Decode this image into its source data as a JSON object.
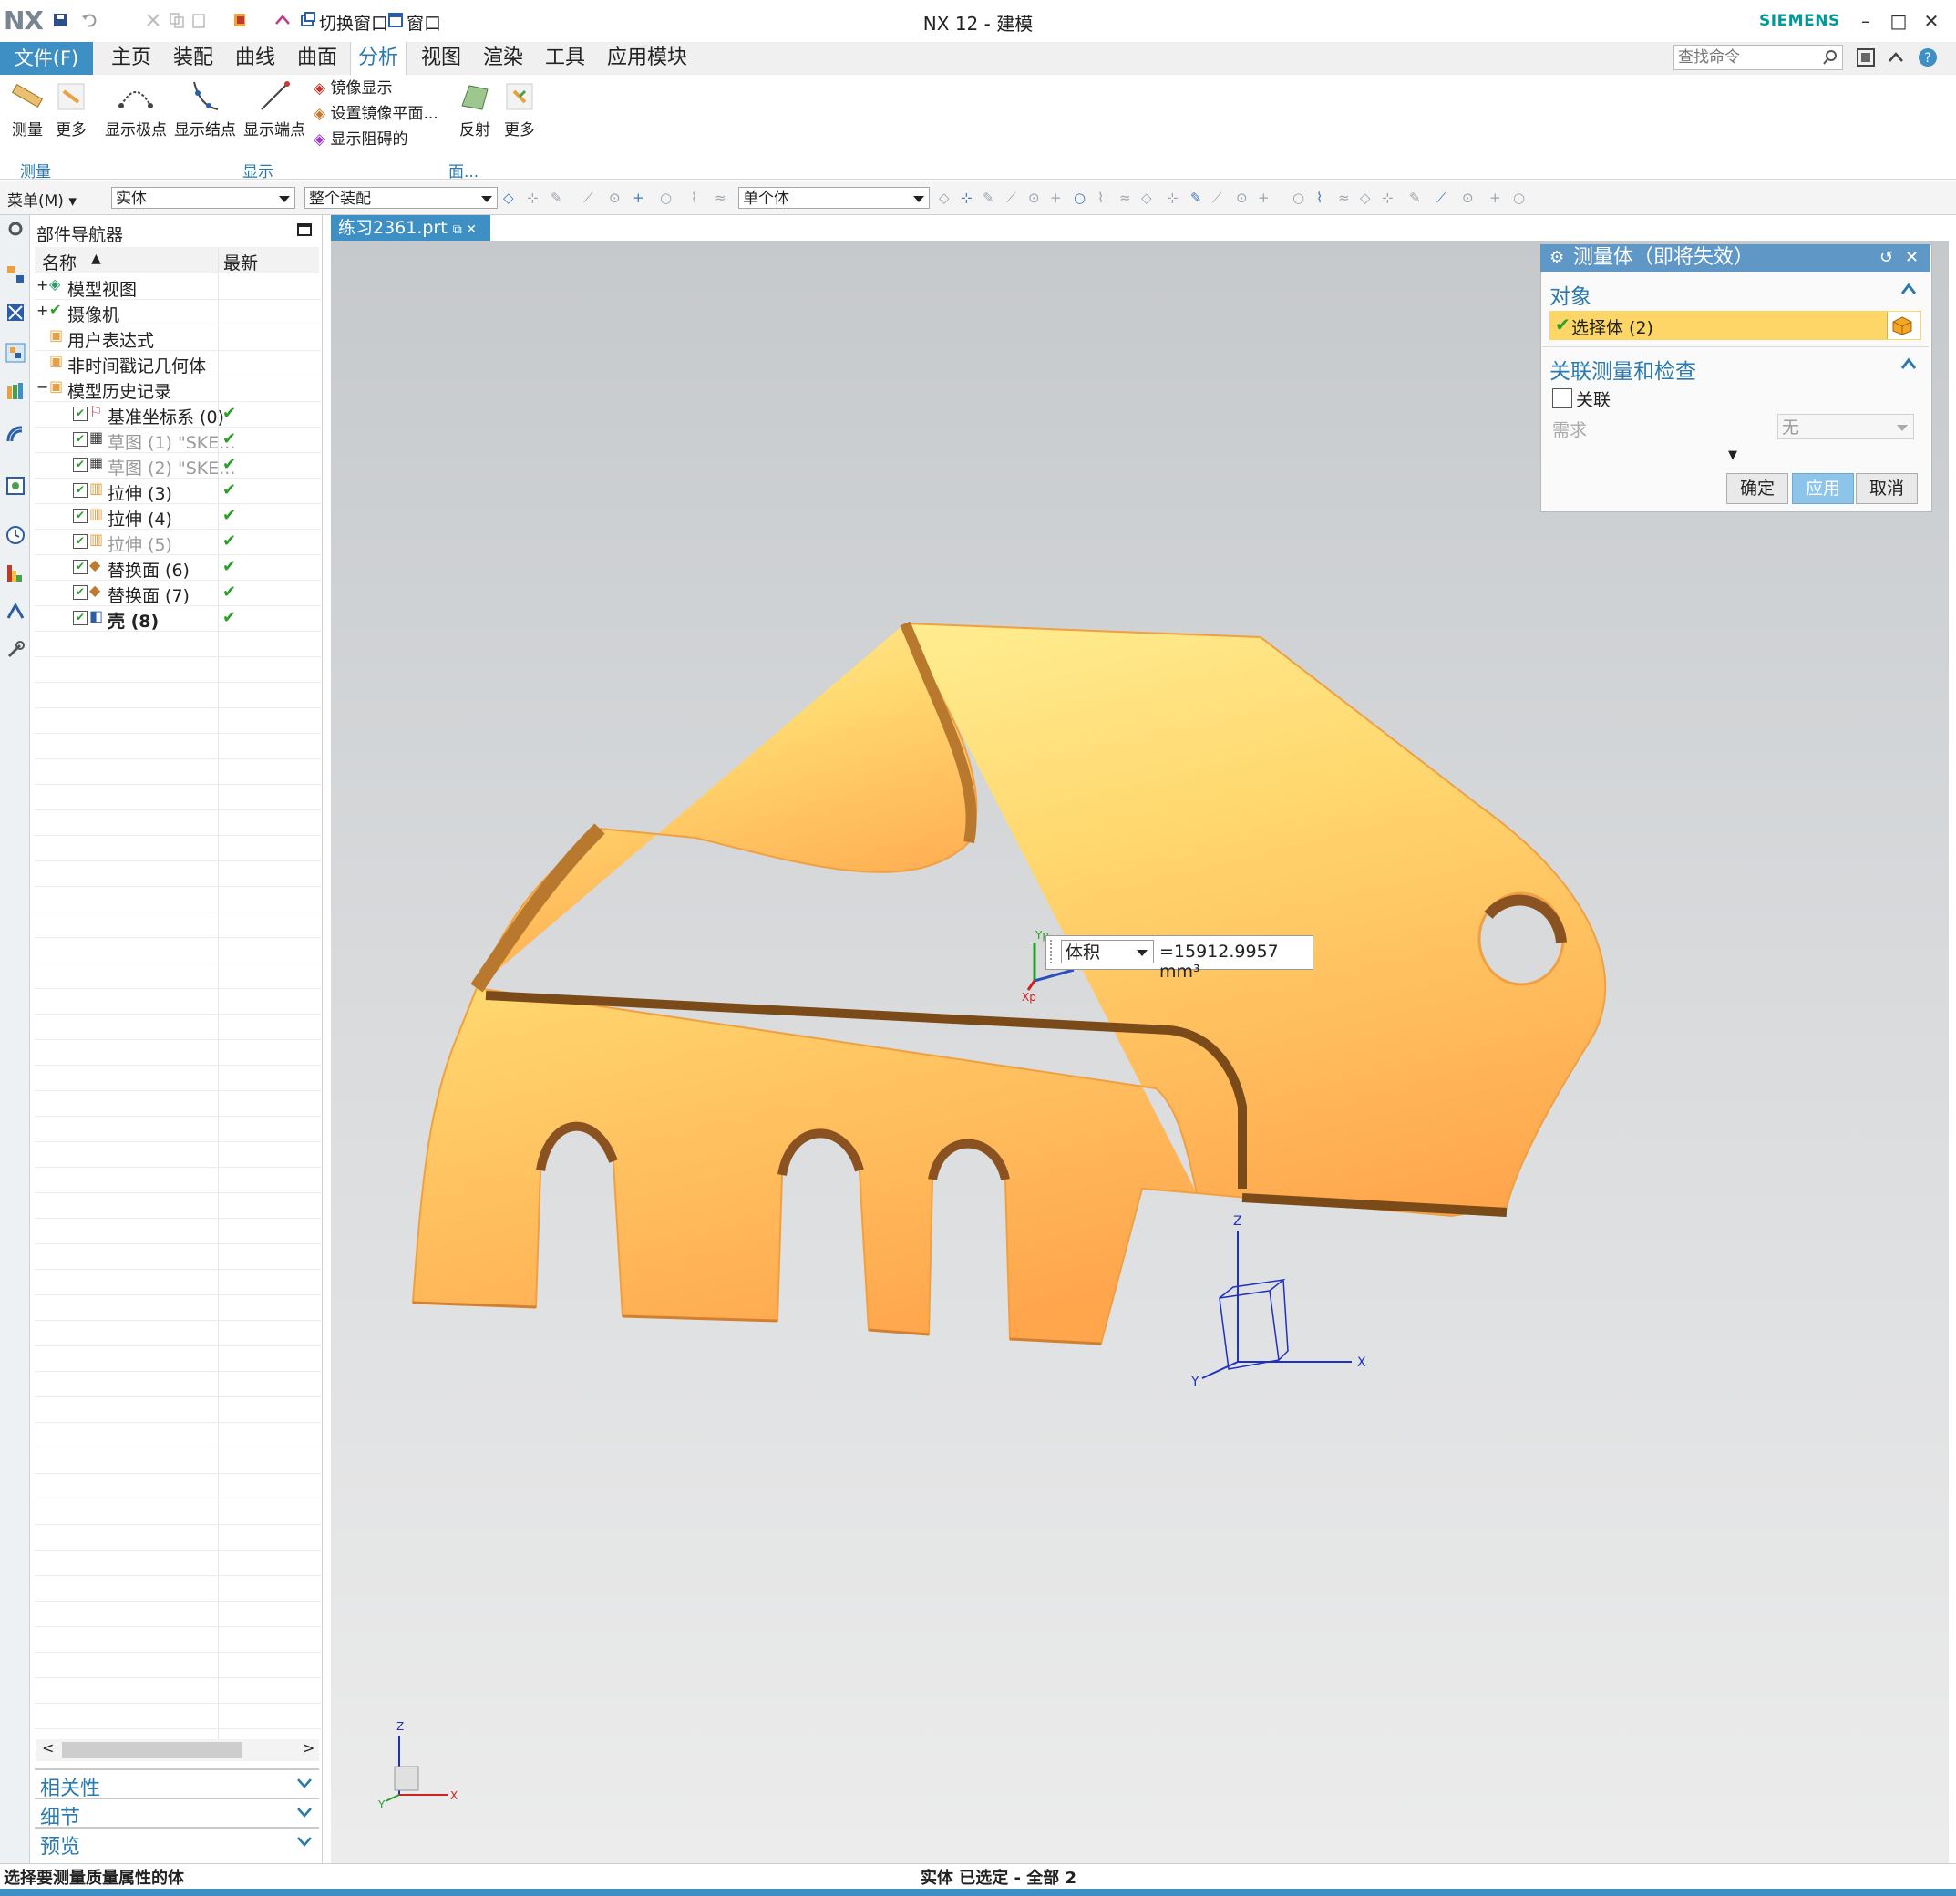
{
  "app": {
    "logo": "NX",
    "title": "NX 12 - 建模",
    "brand": "SIEMENS",
    "quick_access": [
      "切换窗口",
      "窗口"
    ],
    "window_controls": [
      "–",
      "□",
      "✕"
    ]
  },
  "menu": {
    "file": "文件(F)",
    "tabs": [
      "主页",
      "装配",
      "曲线",
      "曲面",
      "分析",
      "视图",
      "渲染",
      "工具",
      "应用模块"
    ],
    "active_tab": "分析",
    "search_placeholder": "查找命令"
  },
  "ribbon": {
    "measure_btn": "测量",
    "more_btn_1": "更多",
    "show_poles": "显示极点",
    "show_knots": "显示结点",
    "show_endpoints": "显示端点",
    "mirror_display": "镜像显示",
    "set_mirror_plane": "设置镜像平面...",
    "show_obstructed": "显示阻碍的",
    "reflect": "反射",
    "more_btn_2": "更多",
    "group_measure": "测量",
    "group_display": "显示",
    "group_face": "面..."
  },
  "toolbar": {
    "menu_btn": "菜单(M)",
    "filter_type": "实体",
    "scope": "整个装配",
    "body_rule": "单个体"
  },
  "navigator": {
    "title": "部件导航器",
    "col_name": "名称",
    "col_latest": "最新",
    "items": [
      {
        "label": "模型视图",
        "dim": false,
        "bold": false,
        "check": false
      },
      {
        "label": "摄像机",
        "dim": false,
        "bold": false,
        "check": false
      },
      {
        "label": "用户表达式",
        "dim": false,
        "bold": false,
        "check": false
      },
      {
        "label": "非时间戳记几何体",
        "dim": false,
        "bold": false,
        "check": false
      },
      {
        "label": "模型历史记录",
        "dim": false,
        "bold": false,
        "check": false
      },
      {
        "label": "基准坐标系 (0)",
        "dim": false,
        "bold": false,
        "check": true
      },
      {
        "label": "草图 (1) \"SKE...",
        "dim": true,
        "bold": false,
        "check": true
      },
      {
        "label": "草图 (2) \"SKE...",
        "dim": true,
        "bold": false,
        "check": true
      },
      {
        "label": "拉伸 (3)",
        "dim": false,
        "bold": false,
        "check": true
      },
      {
        "label": "拉伸 (4)",
        "dim": false,
        "bold": false,
        "check": true
      },
      {
        "label": "拉伸 (5)",
        "dim": true,
        "bold": false,
        "check": true
      },
      {
        "label": "替换面 (6)",
        "dim": false,
        "bold": false,
        "check": true
      },
      {
        "label": "替换面 (7)",
        "dim": false,
        "bold": false,
        "check": true
      },
      {
        "label": "壳 (8)",
        "dim": false,
        "bold": true,
        "check": true
      }
    ],
    "panels": [
      "相关性",
      "细节",
      "预览"
    ]
  },
  "document_tab": "练习2361.prt",
  "dialog": {
    "title": "测量体（即将失效）",
    "section_object": "对象",
    "select_body": "选择体 (2)",
    "section_assoc": "关联测量和检查",
    "assoc_checkbox": "关联",
    "requirement_label": "需求",
    "requirement_value": "无",
    "ok": "确定",
    "apply": "应用",
    "cancel": "取消"
  },
  "measurement": {
    "type": "体积",
    "value": "=15912.9957 mm³",
    "csys_labels": [
      "Yp",
      "Xp"
    ]
  },
  "axes": {
    "x": "X",
    "y": "Y",
    "z": "Z"
  },
  "status": {
    "left": "选择要测量质量属性的体",
    "middle": "实体 已选定 - 全部 2"
  },
  "colors": {
    "accent": "#3d8fc4",
    "part_light": "#ffe680",
    "part_dark": "#ffa64d",
    "selection_bar": "#fdd667",
    "brand": "#009999"
  }
}
